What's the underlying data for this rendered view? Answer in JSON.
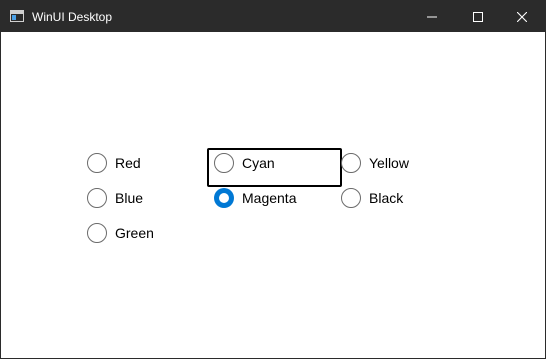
{
  "window": {
    "title": "WinUI Desktop",
    "app_icon": "app-window-icon",
    "controls": {
      "minimize": "minimize-icon",
      "maximize": "maximize-icon",
      "close": "close-icon"
    }
  },
  "radio_group": {
    "options": [
      {
        "label": "Red",
        "checked": false
      },
      {
        "label": "Cyan",
        "checked": false
      },
      {
        "label": "Yellow",
        "checked": false
      },
      {
        "label": "Blue",
        "checked": false
      },
      {
        "label": "Magenta",
        "checked": true,
        "focused": true
      },
      {
        "label": "Black",
        "checked": false
      },
      {
        "label": "Green",
        "checked": false
      }
    ]
  },
  "colors": {
    "titlebar": "#2b2b2b",
    "accent": "#0078d4",
    "background": "#ffffff"
  }
}
